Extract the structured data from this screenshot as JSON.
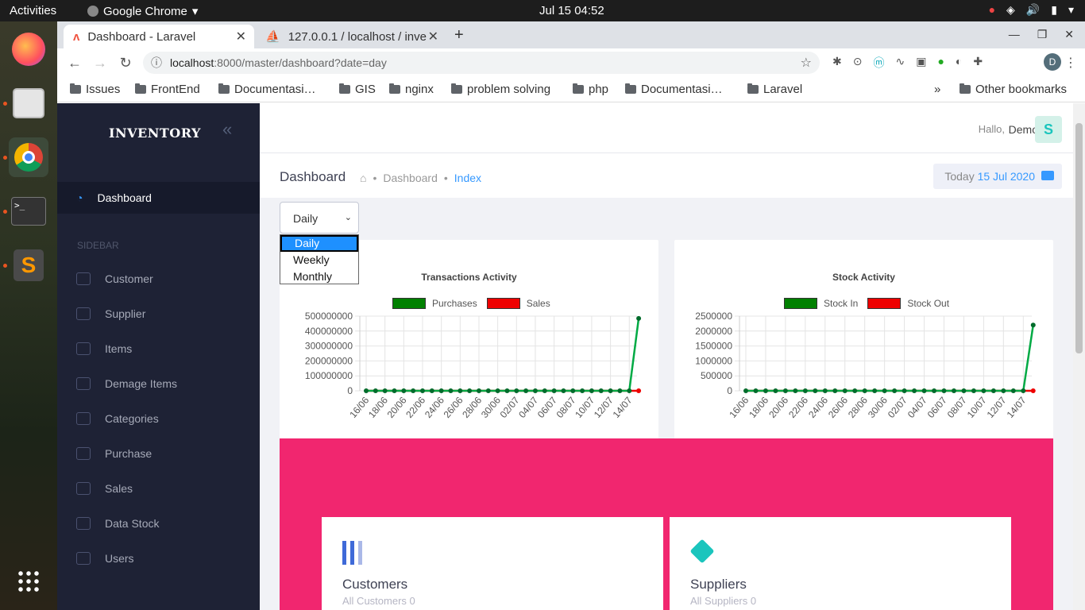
{
  "os": {
    "activities": "Activities",
    "app_name": "Google Chrome",
    "clock": "Jul 15  04:52"
  },
  "browser": {
    "tabs": [
      {
        "title": "Dashboard - Laravel"
      },
      {
        "title": "127.0.0.1 / localhost / inve"
      }
    ],
    "url_host": "localhost",
    "url_path": ":8000/master/dashboard?date=day",
    "bookmarks": [
      "Issues",
      "FrontEnd",
      "Documentasi…",
      "GIS",
      "nginx",
      "problem solving",
      "php",
      "Documentasi…",
      "Laravel"
    ],
    "other_bookmarks": "Other bookmarks",
    "overflow": "»",
    "profile_initial": "D"
  },
  "sidebar": {
    "brand": "INVENTORY",
    "dashboard": "Dashboard",
    "section": "SIDEBAR",
    "items": [
      "Customer",
      "Supplier",
      "Items",
      "Demage Items",
      "Categories",
      "Purchase",
      "Sales",
      "Data Stock",
      "Users"
    ]
  },
  "header": {
    "greeting": "Hallo,",
    "user": "Demo",
    "avatar": "S"
  },
  "subheader": {
    "title": "Dashboard",
    "crumb1": "Dashboard",
    "crumb2": "Index",
    "today_label": "Today",
    "today_date": "15 Jul 2020"
  },
  "filter": {
    "selected": "Daily",
    "options": [
      "Daily",
      "Weekly",
      "Monthly"
    ]
  },
  "chart_data": [
    {
      "type": "line",
      "title": "Transactions Activity",
      "x": [
        "16/06",
        "17/06",
        "18/06",
        "19/06",
        "20/06",
        "21/06",
        "22/06",
        "23/06",
        "24/06",
        "25/06",
        "26/06",
        "27/06",
        "28/06",
        "29/06",
        "30/06",
        "01/07",
        "02/07",
        "03/07",
        "04/07",
        "05/07",
        "06/07",
        "07/07",
        "08/07",
        "09/07",
        "10/07",
        "11/07",
        "12/07",
        "13/07",
        "14/07",
        "15/07"
      ],
      "tick_labels": [
        "16/06",
        "18/06",
        "20/06",
        "22/06",
        "24/06",
        "26/06",
        "28/06",
        "30/06",
        "02/07",
        "04/07",
        "06/07",
        "08/07",
        "10/07",
        "12/07",
        "14/07"
      ],
      "series": [
        {
          "name": "Purchases",
          "color": "#00aa44",
          "values": [
            0,
            0,
            0,
            0,
            0,
            0,
            0,
            0,
            0,
            0,
            0,
            0,
            0,
            0,
            0,
            0,
            0,
            0,
            0,
            0,
            0,
            0,
            0,
            0,
            0,
            0,
            0,
            0,
            0,
            485000000
          ]
        },
        {
          "name": "Sales",
          "color": "#ee0000",
          "values": [
            0,
            0,
            0,
            0,
            0,
            0,
            0,
            0,
            0,
            0,
            0,
            0,
            0,
            0,
            0,
            0,
            0,
            0,
            0,
            0,
            0,
            0,
            0,
            0,
            0,
            0,
            0,
            0,
            0,
            0
          ]
        }
      ],
      "y_ticks": [
        0,
        100000000,
        200000000,
        300000000,
        400000000,
        500000000
      ],
      "ylim": [
        0,
        500000000
      ],
      "legend_colors": [
        "#008000",
        "#ee0000"
      ]
    },
    {
      "type": "line",
      "title": "Stock Activity",
      "x": [
        "16/06",
        "17/06",
        "18/06",
        "19/06",
        "20/06",
        "21/06",
        "22/06",
        "23/06",
        "24/06",
        "25/06",
        "26/06",
        "27/06",
        "28/06",
        "29/06",
        "30/06",
        "01/07",
        "02/07",
        "03/07",
        "04/07",
        "05/07",
        "06/07",
        "07/07",
        "08/07",
        "09/07",
        "10/07",
        "11/07",
        "12/07",
        "13/07",
        "14/07",
        "15/07"
      ],
      "tick_labels": [
        "16/06",
        "18/06",
        "20/06",
        "22/06",
        "24/06",
        "26/06",
        "28/06",
        "30/06",
        "02/07",
        "04/07",
        "06/07",
        "08/07",
        "10/07",
        "12/07",
        "14/07"
      ],
      "series": [
        {
          "name": "Stock In",
          "color": "#00aa44",
          "values": [
            0,
            0,
            0,
            0,
            0,
            0,
            0,
            0,
            0,
            0,
            0,
            0,
            0,
            0,
            0,
            0,
            0,
            0,
            0,
            0,
            0,
            0,
            0,
            0,
            0,
            0,
            0,
            0,
            0,
            2200000
          ]
        },
        {
          "name": "Stock Out",
          "color": "#ee0000",
          "values": [
            0,
            0,
            0,
            0,
            0,
            0,
            0,
            0,
            0,
            0,
            0,
            0,
            0,
            0,
            0,
            0,
            0,
            0,
            0,
            0,
            0,
            0,
            0,
            0,
            0,
            0,
            0,
            0,
            0,
            0
          ]
        }
      ],
      "y_ticks": [
        0,
        500000,
        1000000,
        1500000,
        2000000,
        2500000
      ],
      "ylim": [
        0,
        2500000
      ],
      "legend_colors": [
        "#008000",
        "#ee0000"
      ]
    }
  ],
  "stats": [
    {
      "title": "Customers",
      "subtitle": "All Customers 0"
    },
    {
      "title": "Suppliers",
      "subtitle": "All Suppliers 0"
    }
  ],
  "colors": {
    "accent": "#3699ff",
    "pink": "#f1266f",
    "sidebar": "#1e2235"
  }
}
